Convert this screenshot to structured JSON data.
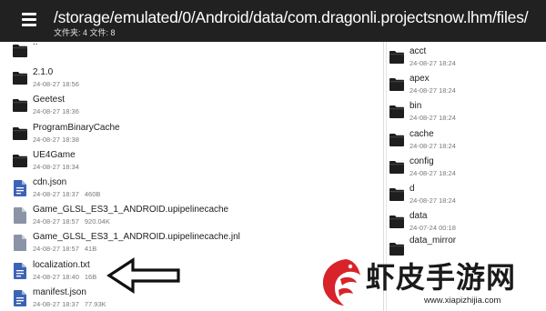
{
  "header": {
    "path": "/storage/emulated/0/Android/data/com.dragonli.projectsnow.lhm/files/",
    "counts": "文件夹: 4  文件: 8"
  },
  "left_list": [
    {
      "name": "..",
      "meta": "",
      "size": "",
      "type": "folder",
      "icon": "folder-icon"
    },
    {
      "name": "2.1.0",
      "meta": "24-08-27 18:56",
      "size": "",
      "type": "folder",
      "icon": "folder-icon"
    },
    {
      "name": "Geetest",
      "meta": "24-08-27 18:36",
      "size": "",
      "type": "folder",
      "icon": "folder-icon"
    },
    {
      "name": "ProgramBinaryCache",
      "meta": "24-08-27 18:38",
      "size": "",
      "type": "folder",
      "icon": "folder-icon"
    },
    {
      "name": "UE4Game",
      "meta": "24-08-27 18:34",
      "size": "",
      "type": "folder",
      "icon": "folder-icon"
    },
    {
      "name": "cdn.json",
      "meta": "24-08-27 18:37",
      "size": "460B",
      "type": "doc",
      "icon": "document-icon"
    },
    {
      "name": "Game_GLSL_ES3_1_ANDROID.upipelinecache",
      "meta": "24-08-27 18:57",
      "size": "920.04K",
      "type": "file",
      "icon": "file-icon"
    },
    {
      "name": "Game_GLSL_ES3_1_ANDROID.upipelinecache.jnl",
      "meta": "24-08-27 18:57",
      "size": "41B",
      "type": "file",
      "icon": "file-icon"
    },
    {
      "name": "localization.txt",
      "meta": "24-08-27 18:40",
      "size": "16B",
      "type": "doc",
      "icon": "document-icon"
    },
    {
      "name": "manifest.json",
      "meta": "24-08-27 18:37",
      "size": "77.93K",
      "type": "doc",
      "icon": "document-icon"
    }
  ],
  "right_list": [
    {
      "name": "acct",
      "meta": "24-08-27 18:24",
      "icon": "folder-icon"
    },
    {
      "name": "apex",
      "meta": "24-08-27 18:24",
      "icon": "folder-icon"
    },
    {
      "name": "bin",
      "meta": "24-08-27 18:24",
      "icon": "folder-icon"
    },
    {
      "name": "cache",
      "meta": "24-08-27 18:24",
      "icon": "folder-icon"
    },
    {
      "name": "config",
      "meta": "24-08-27 18:24",
      "icon": "folder-icon"
    },
    {
      "name": "d",
      "meta": "24-08-27 18:24",
      "icon": "folder-icon"
    },
    {
      "name": "data",
      "meta": "24-07-24 00:18",
      "icon": "folder-icon"
    },
    {
      "name": "data_mirror",
      "meta": "",
      "icon": "folder-icon"
    }
  ],
  "watermark": {
    "title": "虾皮手游网",
    "url": "www.xiapizhijia.com"
  },
  "colors": {
    "header_bg": "#212121",
    "folder": "#1e1e1e",
    "doc": "#3d63b5",
    "file": "#8a94a6",
    "arrow": "#111111",
    "logo_red": "#d8232a"
  }
}
